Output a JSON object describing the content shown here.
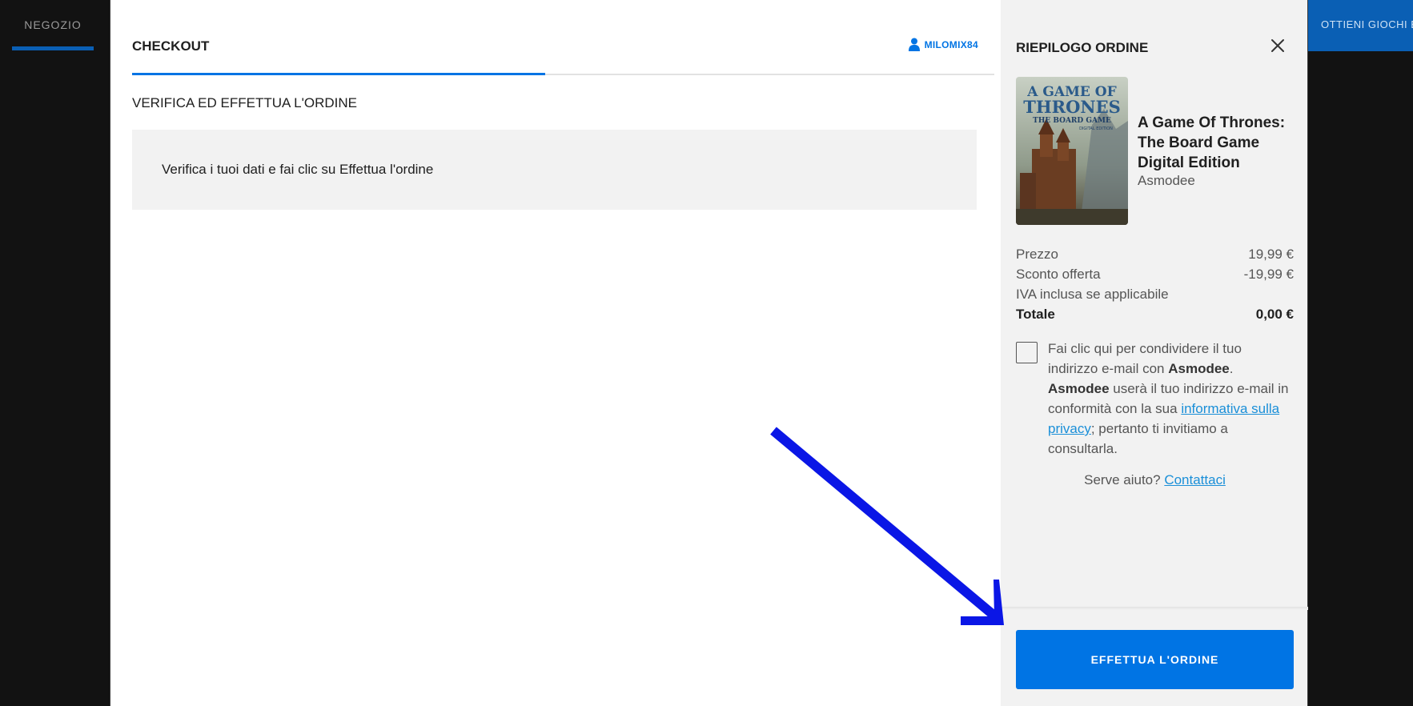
{
  "nav": {
    "store": "NEGOZIO",
    "get_games": "OTTIENI GIOCHI EP"
  },
  "checkout": {
    "title": "CHECKOUT",
    "username": "MILOMIX84",
    "section_title": "VERIFICA ED EFFETTUA L'ORDINE",
    "info_text": "Verifica i tuoi dati e fai clic su Effettua l'ordine"
  },
  "summary": {
    "title": "RIEPILOGO ORDINE",
    "game_title": "A Game Of Thrones: The Board Game Digital Edition",
    "publisher": "Asmodee",
    "cover_text": {
      "line1": "A GAME OF",
      "line2": "THRONES",
      "line3": "THE BOARD GAME",
      "line4": "DIGITAL EDITION"
    },
    "price_label": "Prezzo",
    "price_value": "19,99 €",
    "discount_label": "Sconto offerta",
    "discount_value": "-19,99 €",
    "vat_label": "IVA inclusa se applicabile",
    "total_label": "Totale",
    "total_value": "0,00 €",
    "consent": {
      "part1": "Fai clic qui per condividere il tuo indirizzo e-mail con ",
      "publisher_a": "Asmodee",
      "part2": ". ",
      "publisher_b": "Asmodee",
      "part3": " userà il tuo indirizzo e-mail in conformità con la sua ",
      "link": "informativa sulla privacy",
      "part4": "; pertanto ti invitiamo a consultarla."
    },
    "help_text": "Serve aiuto?",
    "help_link": "Contattaci",
    "order_button": "EFFETTUA L'ORDINE"
  },
  "colors": {
    "accent": "#0074e4",
    "arrow": "#0a16e6",
    "panel": "#f2f2f2"
  }
}
